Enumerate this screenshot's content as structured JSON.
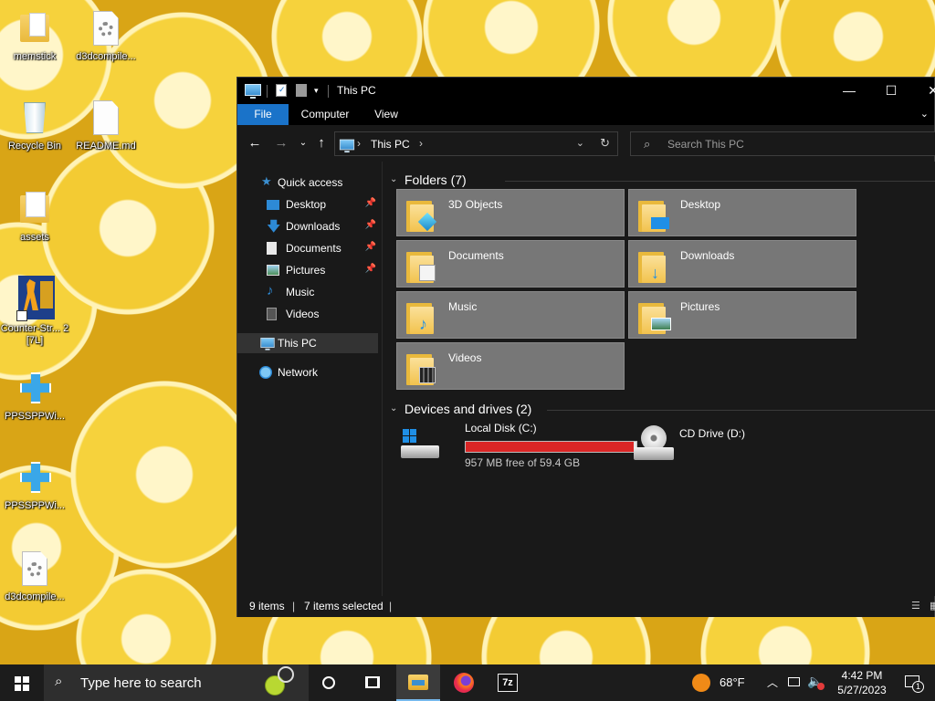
{
  "desktop": {
    "icons": [
      {
        "label": "memstick",
        "icon": "folder-icon"
      },
      {
        "label": "d3dcompile...",
        "icon": "settings-file-icon"
      },
      {
        "label": "Recycle Bin",
        "icon": "recycle-bin-icon"
      },
      {
        "label": "README.md",
        "icon": "document-icon"
      },
      {
        "label": "assets",
        "icon": "folder-icon"
      },
      {
        "label": "Counter-Str... 2 [7L]",
        "icon": "counter-strike-icon"
      },
      {
        "label": "PPSSPPWi...",
        "icon": "ppsspp-icon"
      },
      {
        "label": "PPSSPPWi...",
        "icon": "ppsspp-icon"
      },
      {
        "label": "d3dcompile...",
        "icon": "settings-file-icon"
      }
    ]
  },
  "explorer": {
    "title": "This PC",
    "ribbon_tabs": [
      "File",
      "Computer",
      "View"
    ],
    "address": {
      "crumb": "This PC"
    },
    "search_placeholder": "Search This PC",
    "nav": {
      "quick_access": "Quick access",
      "items": [
        "Desktop",
        "Downloads",
        "Documents",
        "Pictures",
        "Music",
        "Videos"
      ],
      "this_pc": "This PC",
      "network": "Network"
    },
    "folders_header": "Folders (7)",
    "folders": [
      "3D Objects",
      "Desktop",
      "Documents",
      "Downloads",
      "Music",
      "Pictures",
      "Videos"
    ],
    "devices_header": "Devices and drives (2)",
    "drives": [
      {
        "name": "Local Disk (C:)",
        "free_text": "957 MB free of 59.4 GB",
        "used_fraction": 0.984
      },
      {
        "name": "CD Drive (D:)"
      }
    ],
    "status": {
      "items": "9 items",
      "selected": "7 items selected"
    }
  },
  "taskbar": {
    "search_placeholder": "Type here to search",
    "weather": "68°F",
    "time": "4:42 PM",
    "date": "5/27/2023",
    "notifications": "1"
  },
  "colors": {
    "accent": "#1a73c9",
    "disk_bar": "#da2626",
    "tile": "#777777"
  }
}
